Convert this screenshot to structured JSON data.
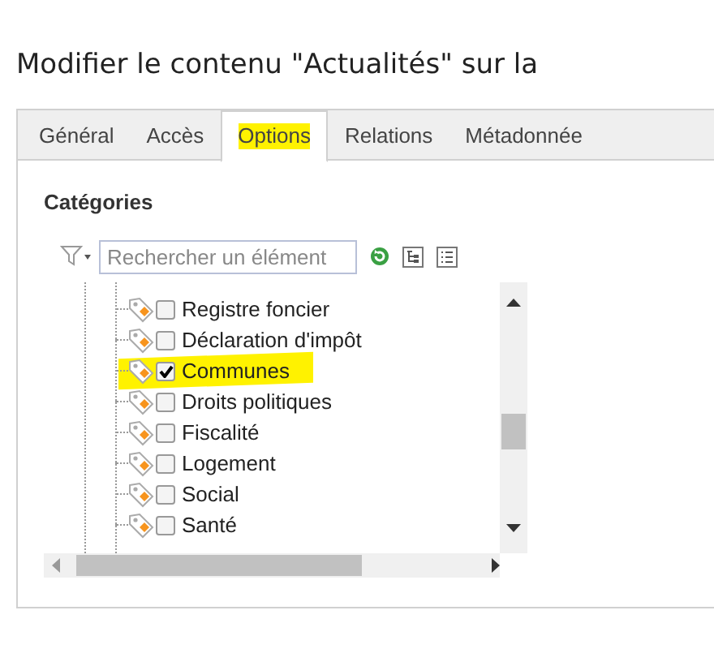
{
  "page_title": "Modifier le contenu \"Actualités\" sur la",
  "tabs": [
    {
      "label": "Général",
      "selected": false,
      "highlighted": false
    },
    {
      "label": "Accès",
      "selected": false,
      "highlighted": false
    },
    {
      "label": "Options",
      "selected": true,
      "highlighted": true
    },
    {
      "label": "Relations",
      "selected": false,
      "highlighted": false
    },
    {
      "label": "Métadonnée",
      "selected": false,
      "highlighted": false
    }
  ],
  "section_title": "Catégories",
  "search": {
    "placeholder": "Rechercher un élément"
  },
  "tree_items": [
    {
      "label": "Registre foncier",
      "checked": false,
      "highlighted": false
    },
    {
      "label": "Déclaration d'impôt",
      "checked": false,
      "highlighted": false
    },
    {
      "label": "Communes",
      "checked": true,
      "highlighted": true
    },
    {
      "label": "Droits politiques",
      "checked": false,
      "highlighted": false
    },
    {
      "label": "Fiscalité",
      "checked": false,
      "highlighted": false
    },
    {
      "label": "Logement",
      "checked": false,
      "highlighted": false
    },
    {
      "label": "Social",
      "checked": false,
      "highlighted": false
    },
    {
      "label": "Santé",
      "checked": false,
      "highlighted": false
    }
  ]
}
